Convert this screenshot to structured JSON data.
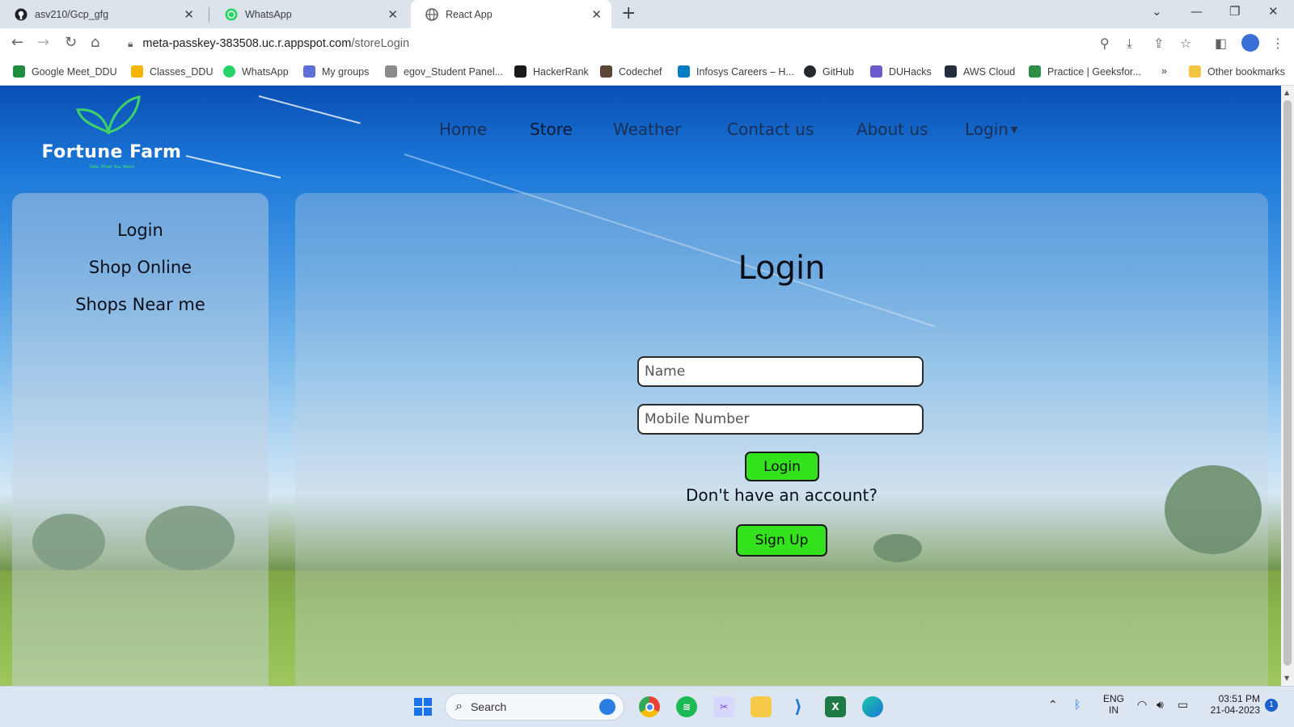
{
  "browser": {
    "tabs": [
      {
        "title": "asv210/Gcp_gfg",
        "icon": "github-icon"
      },
      {
        "title": "WhatsApp",
        "icon": "whatsapp-icon"
      },
      {
        "title": "React App",
        "icon": "globe-icon"
      }
    ],
    "url": {
      "host": "meta-passkey-383508.uc.r.appspot.com",
      "path": "/storeLogin"
    },
    "bookmarks": [
      {
        "label": "Google Meet_DDU",
        "color": "#1e8e3e"
      },
      {
        "label": "Classes_DDU",
        "color": "#f4b400"
      },
      {
        "label": "WhatsApp",
        "color": "#25d366"
      },
      {
        "label": "My groups",
        "color": "#5b6fd6"
      },
      {
        "label": "egov_Student Panel...",
        "color": "#8a8a8a"
      },
      {
        "label": "HackerRank",
        "color": "#1a1a1a"
      },
      {
        "label": "Codechef",
        "color": "#5b4638"
      },
      {
        "label": "Infosys Careers – H...",
        "color": "#007cc3"
      },
      {
        "label": "GitHub",
        "color": "#24292f"
      },
      {
        "label": "DUHacks",
        "color": "#6a5acd"
      },
      {
        "label": "AWS Cloud",
        "color": "#232f3e"
      },
      {
        "label": "Practice | Geeksfor...",
        "color": "#2f8d46"
      }
    ],
    "more_bookmarks": "»",
    "other_bookmarks": "Other bookmarks"
  },
  "site": {
    "brand": "Fortune Farm",
    "tagline": "Take What You Want",
    "nav": [
      "Home",
      "Store",
      "Weather",
      "Contact us",
      "About us",
      "Login"
    ],
    "active_nav": "Store",
    "sidebar": [
      "Login",
      "Shop Online",
      "Shops Near me"
    ],
    "login": {
      "heading": "Login",
      "name_placeholder": "Name",
      "mobile_placeholder": "Mobile Number",
      "login_button": "Login",
      "prompt": "Don't have an account?",
      "signup_button": "Sign Up"
    }
  },
  "taskbar": {
    "search_placeholder": "Search",
    "lang_top": "ENG",
    "lang_bottom": "IN",
    "time": "03:51 PM",
    "date": "21-04-2023",
    "notifications": "1"
  },
  "colors": {
    "accent_button": "#33e21c",
    "sky_top": "#0a4fb5"
  }
}
